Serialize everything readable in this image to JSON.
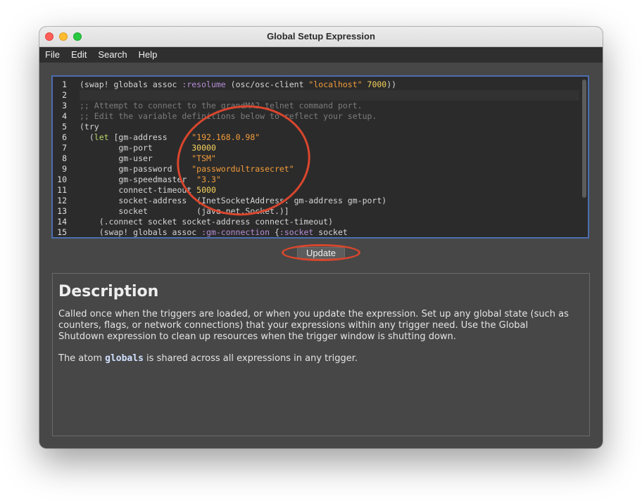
{
  "window": {
    "title": "Global Setup Expression"
  },
  "menu": [
    "File",
    "Edit",
    "Search",
    "Help"
  ],
  "editor": {
    "line_numbers": [
      "1",
      "2",
      "3",
      "4",
      "5",
      "6",
      "7",
      "8",
      "9",
      "10",
      "11",
      "12",
      "13",
      "14",
      "15"
    ],
    "lines": [
      [
        [
          "(swap! globals assoc ",
          ""
        ],
        [
          ":resolume",
          "key"
        ],
        [
          " (osc/osc-client ",
          ""
        ],
        [
          "\"localhost\"",
          "str"
        ],
        [
          " ",
          ""
        ],
        [
          "7000",
          "num"
        ],
        [
          "))",
          ""
        ]
      ],
      [],
      [
        [
          ";; Attempt to connect to the grandMA2 telnet command port.",
          "cmt"
        ]
      ],
      [
        [
          ";; Edit the variable definitions below to reflect your setup.",
          "cmt"
        ]
      ],
      [
        [
          "(try",
          ""
        ]
      ],
      [
        [
          "  (",
          ""
        ],
        [
          "let",
          "let"
        ],
        [
          " [gm-address     ",
          ""
        ],
        [
          "\"192.168.0.98\"",
          "str"
        ]
      ],
      [
        [
          "        gm-port        ",
          ""
        ],
        [
          "30000",
          "num"
        ]
      ],
      [
        [
          "        gm-user        ",
          ""
        ],
        [
          "\"TSM\"",
          "str"
        ]
      ],
      [
        [
          "        gm-password    ",
          ""
        ],
        [
          "\"passwordultrasecret\"",
          "str"
        ]
      ],
      [
        [
          "        gm-speedmaster  ",
          ""
        ],
        [
          "\"3.3\"",
          "str"
        ]
      ],
      [
        [
          "        connect-timeout ",
          ""
        ],
        [
          "5000",
          "num"
        ]
      ],
      [
        [
          "        socket-address  (InetSocketAddress. gm-address gm-port)",
          ""
        ]
      ],
      [
        [
          "        socket          (java.net.Socket.)]",
          ""
        ]
      ],
      [
        [
          "    (.connect socket socket-address connect-timeout)",
          ""
        ]
      ],
      [
        [
          "    (swap! globals assoc ",
          ""
        ],
        [
          ":gm-connection",
          "key"
        ],
        [
          " {",
          ""
        ],
        [
          ":socket",
          "key"
        ],
        [
          " socket",
          ""
        ]
      ]
    ],
    "current_line": 2
  },
  "update_button": {
    "label": "Update"
  },
  "description": {
    "heading": "Description",
    "paragraph1": "Called once when the triggers are loaded, or when you update the expression. Set up any global state (such as counters, flags, or network connections) that your expressions within any trigger need. Use the Global Shutdown expression to clean up resources when the trigger window is shutting down.",
    "paragraph2_before": "The atom ",
    "paragraph2_code": "globals",
    "paragraph2_after": " is shared across all expressions in any trigger."
  },
  "colors": {
    "window_bg": "#474747",
    "editor_bg": "#2b2b2b",
    "editor_border": "#4b6eaf",
    "annotation": "#d9462d"
  }
}
